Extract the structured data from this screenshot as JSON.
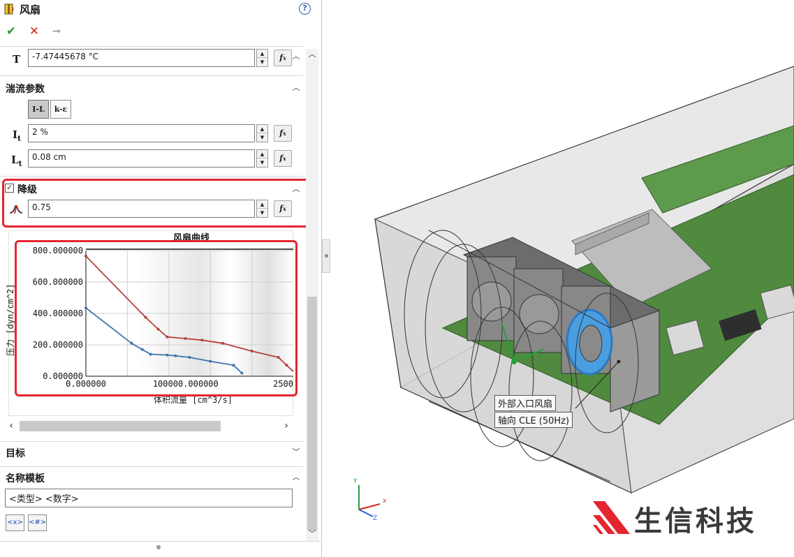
{
  "header": {
    "title": "风扇",
    "help_icon": "?"
  },
  "actions": {
    "ok_icon": "✔",
    "cancel_icon": "✕",
    "pin_icon": "⊸"
  },
  "temperature": {
    "label": "T",
    "value": "-7.47445678 °C"
  },
  "turbulence": {
    "title": "湍流参数",
    "modes": [
      "I-L",
      "k-ε"
    ],
    "intensity": {
      "label": "I",
      "sub": "t",
      "value": "2 %"
    },
    "length": {
      "label": "L",
      "sub": "t",
      "value": "0.08 cm"
    }
  },
  "derating": {
    "title": "降级",
    "checked": true,
    "value": "0.75"
  },
  "fx_label": "f<sub>x</sub>",
  "chart_data": {
    "type": "line",
    "title": "风扇曲线",
    "xlabel": "体积流量 [cm^3/s]",
    "ylabel": "压力 [dyn/cm^2]",
    "x_tick_labels": [
      "0.000000",
      "100000.000000",
      "2500"
    ],
    "y_tick_labels": [
      "800.000000",
      "600.000000",
      "400.000000",
      "200.000000",
      "0.000000"
    ],
    "xlim": [
      0,
      250000
    ],
    "ylim": [
      0,
      800
    ],
    "grid": true,
    "series": [
      {
        "color": "#b5423d",
        "x": [
          0,
          72000,
          87000,
          98000,
          120000,
          140000,
          165000,
          200000,
          232000,
          242000,
          254000
        ],
        "y": [
          765,
          375,
          300,
          250,
          240,
          230,
          210,
          160,
          120,
          70,
          10
        ]
      },
      {
        "color": "#3f72ad",
        "x": [
          0,
          55000,
          68000,
          78000,
          98000,
          108000,
          125000,
          150000,
          178000,
          188000
        ],
        "y": [
          435,
          210,
          170,
          140,
          135,
          130,
          120,
          95,
          70,
          20
        ]
      }
    ]
  },
  "goals": {
    "title": "目标"
  },
  "name_template": {
    "title": "名称模板",
    "value": "<类型> <数字>",
    "buttons": [
      "<x>",
      "<#>"
    ]
  },
  "viewport": {
    "tooltip_name": "外部入口风扇",
    "tooltip_type": "轴向 CLE (50Hz)",
    "triad": {
      "x": "x",
      "y": "Y",
      "z": "Z"
    },
    "logo_text": "生信科技"
  }
}
